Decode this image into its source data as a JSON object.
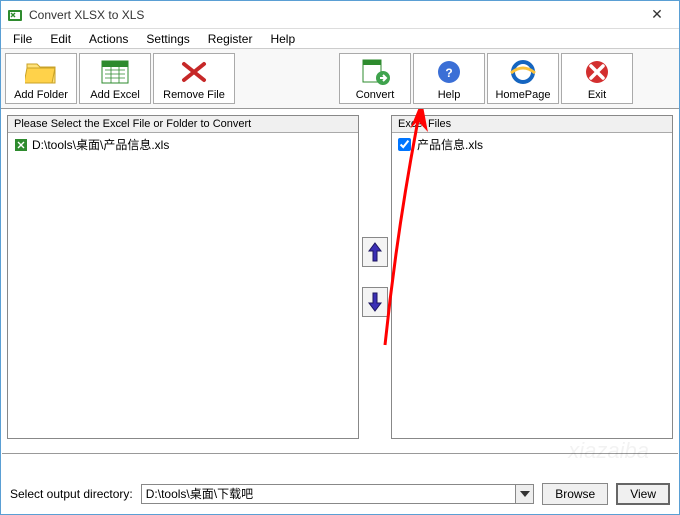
{
  "window": {
    "title": "Convert XLSX to XLS",
    "close": "✕"
  },
  "menu": {
    "items": [
      "File",
      "Edit",
      "Actions",
      "Settings",
      "Register",
      "Help"
    ]
  },
  "toolbar": {
    "add_folder": "Add Folder",
    "add_excel": "Add Excel",
    "remove_file": "Remove File",
    "convert": "Convert",
    "help": "Help",
    "homepage": "HomePage",
    "exit": "Exit"
  },
  "left_panel": {
    "header": "Please Select the Excel File or Folder to Convert",
    "rows": [
      "D:\\tools\\桌面\\产品信息.xls"
    ]
  },
  "right_panel": {
    "header": "Excel Files",
    "rows": [
      "产品信息.xls"
    ]
  },
  "output": {
    "label": "Select  output directory:",
    "path": "D:\\tools\\桌面\\下载吧",
    "browse": "Browse",
    "view": "View"
  },
  "icons": {
    "folder": "folder-icon",
    "excel": "excel-icon",
    "remove": "remove-icon",
    "convert": "convert-icon",
    "help": "help-icon",
    "homepage": "ie-icon",
    "exit": "exit-icon",
    "up": "arrow-up-icon",
    "down": "arrow-down-icon"
  }
}
